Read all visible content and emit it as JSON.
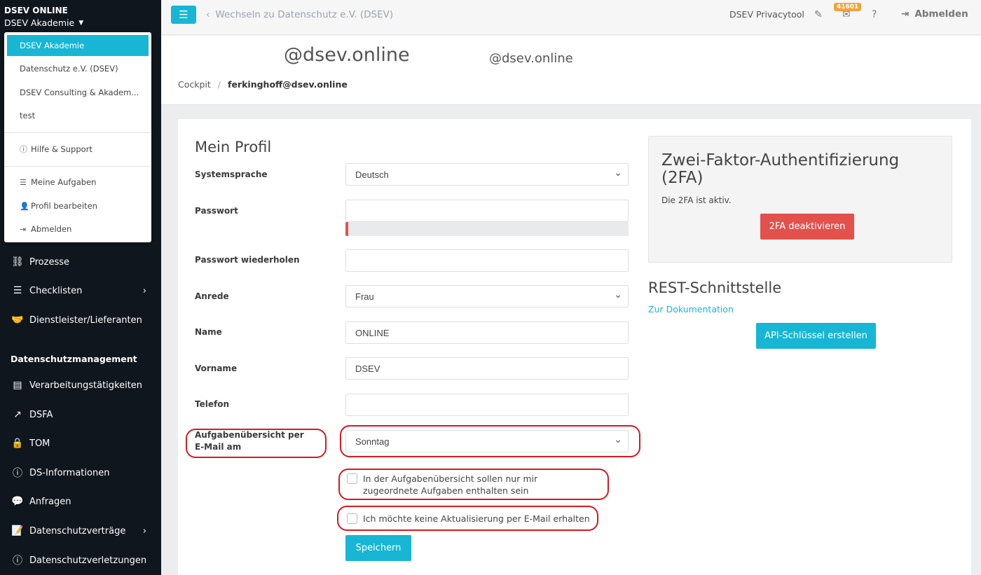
{
  "sidebar": {
    "org_name": "DSEV ONLINE",
    "org_switch": "DSEV Akademie",
    "dropdown": [
      {
        "label": "DSEV Akademie"
      },
      {
        "label": "Datenschutz e.V. (DSEV)"
      },
      {
        "label": "DSEV Consulting & Akadem..."
      },
      {
        "label": "test"
      },
      {
        "label": "Hilfe & Support"
      },
      {
        "label": "Meine Aufgaben"
      },
      {
        "label": "Profil bearbeiten"
      },
      {
        "label": "Abmelden"
      }
    ],
    "nav": [
      {
        "label": "Prozesse"
      },
      {
        "label": "Checklisten"
      },
      {
        "label": "Dienstleister/Lieferanten"
      }
    ],
    "section_heading": "Datenschutzmanagement",
    "nav2": [
      {
        "label": "Verarbeitungstätigkeiten"
      },
      {
        "label": "DSFA"
      },
      {
        "label": "TOM"
      },
      {
        "label": "DS-Informationen"
      },
      {
        "label": "Anfragen"
      },
      {
        "label": "Datenschutzverträge"
      },
      {
        "label": "Datenschutzverletzungen"
      }
    ]
  },
  "topbar": {
    "switch_link": "Wechseln zu Datenschutz e.V. (DSEV)",
    "app_name": "DSEV Privacytool",
    "badge": "41601",
    "logout": "Abmelden"
  },
  "header": {
    "email_big": "@dsev.online",
    "email_small": "@dsev.online",
    "breadcrumb": [
      "Cockpit",
      "ferkinghoff@dsev.online"
    ]
  },
  "profile": {
    "title": "Mein Profil",
    "language_label": "Systemsprache",
    "language_value": "Deutsch",
    "password_label": "Passwort",
    "password_repeat_label": "Passwort wiederholen",
    "salutation_label": "Anrede",
    "salutation_value": "Frau",
    "name_label": "Name",
    "name_value": "ONLINE",
    "firstname_label": "Vorname",
    "firstname_value": "DSEV",
    "phone_label": "Telefon",
    "phone_value": "",
    "task_mail_label": "Aufgabenübersicht per E-Mail am",
    "task_mail_value": "Sonntag",
    "checkbox_own_tasks": "In der Aufgabenübersicht sollen nur mir zugeordnete Aufgaben enthalten sein",
    "checkbox_no_mail": "Ich möchte keine Aktualisierung per E-Mail erhalten",
    "save_label": "Speichern"
  },
  "twofa": {
    "title": "Zwei-Faktor-Authentifizierung (2FA)",
    "status": "Die 2FA ist aktiv.",
    "button": "2FA deaktivieren"
  },
  "rest": {
    "title": "REST-Schnittstelle",
    "doc_link": "Zur Dokumentation",
    "button": "API-Schlüssel erstellen"
  },
  "colors": {
    "accent": "#17b6d4",
    "danger": "#e2514c",
    "sidebar": "#10161d",
    "highlight": "#d7191f"
  }
}
